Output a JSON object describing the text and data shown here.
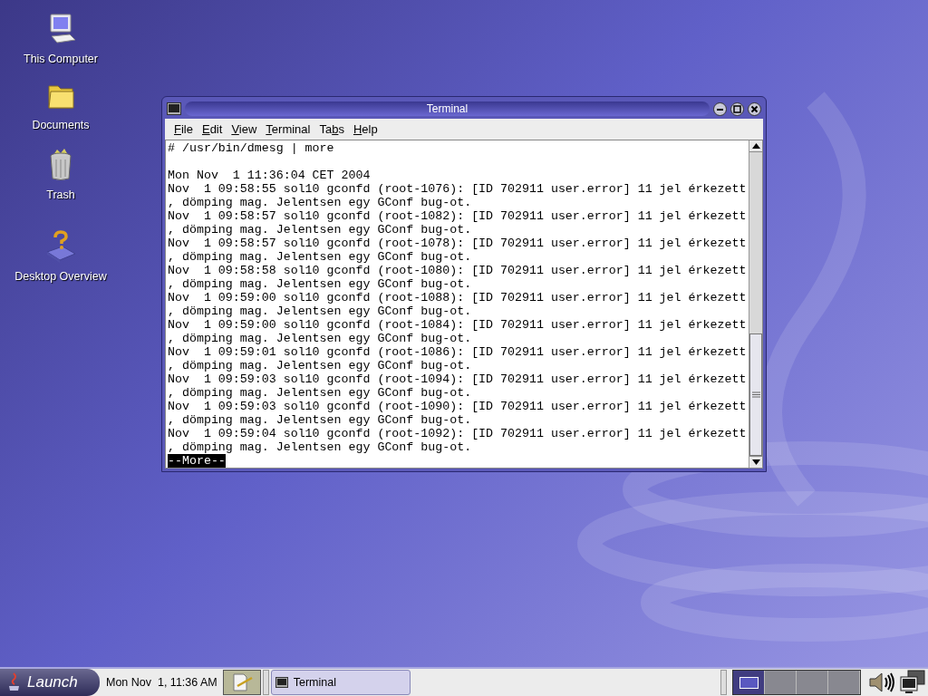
{
  "desktop_icons": [
    {
      "kind": "computer",
      "label": "This Computer"
    },
    {
      "kind": "folder",
      "label": "Documents"
    },
    {
      "kind": "trash",
      "label": "Trash"
    },
    {
      "kind": "help",
      "label": "Desktop Overview"
    }
  ],
  "window": {
    "title": "Terminal",
    "menu": [
      {
        "key": "F",
        "post": "ile"
      },
      {
        "key": "E",
        "post": "dit"
      },
      {
        "key": "V",
        "post": "iew"
      },
      {
        "key": "T",
        "post": "erminal"
      },
      {
        "pre": "Ta",
        "key": "b",
        "post": "s"
      },
      {
        "key": "H",
        "post": "elp"
      }
    ],
    "command": "# /usr/bin/dmesg | more",
    "lines": [
      "Mon Nov  1 11:36:04 CET 2004",
      "Nov  1 09:58:55 sol10 gconfd (root-1076): [ID 702911 user.error] 11 jel érkezett",
      ", dömping mag. Jelentsen egy GConf bug-ot.",
      "Nov  1 09:58:57 sol10 gconfd (root-1082): [ID 702911 user.error] 11 jel érkezett",
      ", dömping mag. Jelentsen egy GConf bug-ot.",
      "Nov  1 09:58:57 sol10 gconfd (root-1078): [ID 702911 user.error] 11 jel érkezett",
      ", dömping mag. Jelentsen egy GConf bug-ot.",
      "Nov  1 09:58:58 sol10 gconfd (root-1080): [ID 702911 user.error] 11 jel érkezett",
      ", dömping mag. Jelentsen egy GConf bug-ot.",
      "Nov  1 09:59:00 sol10 gconfd (root-1088): [ID 702911 user.error] 11 jel érkezett",
      ", dömping mag. Jelentsen egy GConf bug-ot.",
      "Nov  1 09:59:00 sol10 gconfd (root-1084): [ID 702911 user.error] 11 jel érkezett",
      ", dömping mag. Jelentsen egy GConf bug-ot.",
      "Nov  1 09:59:01 sol10 gconfd (root-1086): [ID 702911 user.error] 11 jel érkezett",
      ", dömping mag. Jelentsen egy GConf bug-ot.",
      "Nov  1 09:59:03 sol10 gconfd (root-1094): [ID 702911 user.error] 11 jel érkezett",
      ", dömping mag. Jelentsen egy GConf bug-ot.",
      "Nov  1 09:59:03 sol10 gconfd (root-1090): [ID 702911 user.error] 11 jel érkezett",
      ", dömping mag. Jelentsen egy GConf bug-ot.",
      "Nov  1 09:59:04 sol10 gconfd (root-1092): [ID 702911 user.error] 11 jel érkezett",
      ", dömping mag. Jelentsen egy GConf bug-ot."
    ],
    "pager_prompt": "--More--"
  },
  "taskbar": {
    "launch": "Launch",
    "clock": "Mon Nov  1, 11:36 AM",
    "tasks": [
      {
        "label": "Terminal",
        "selected": false
      }
    ],
    "workspaces": [
      {
        "selected": true
      },
      {
        "selected": false
      },
      {
        "selected": false
      },
      {
        "selected": false
      }
    ]
  }
}
